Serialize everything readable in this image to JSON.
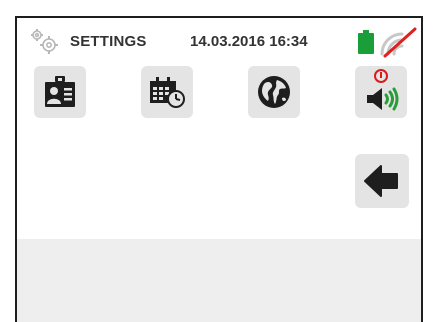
{
  "header": {
    "title": "SETTINGS",
    "datetime": "14.03.2016 16:34",
    "icons": [
      "gears-icon",
      "battery-icon",
      "wifi-off-icon"
    ]
  },
  "menu": {
    "items": [
      {
        "name": "operator-id",
        "icon": "id-card-icon"
      },
      {
        "name": "date-time",
        "icon": "calendar-clock-icon"
      },
      {
        "name": "language",
        "icon": "globe-icon"
      },
      {
        "name": "sound",
        "icon": "speaker-sound-icon"
      }
    ],
    "back": {
      "icon": "back-arrow-icon"
    }
  },
  "colors": {
    "battery": "#1a9e3a",
    "wifi_strike": "#e02020",
    "sound_waves": "#2a9d3a",
    "alert": "#d81c1c",
    "tile": "#e4e4e4",
    "bottom_band": "#eeeeee"
  }
}
